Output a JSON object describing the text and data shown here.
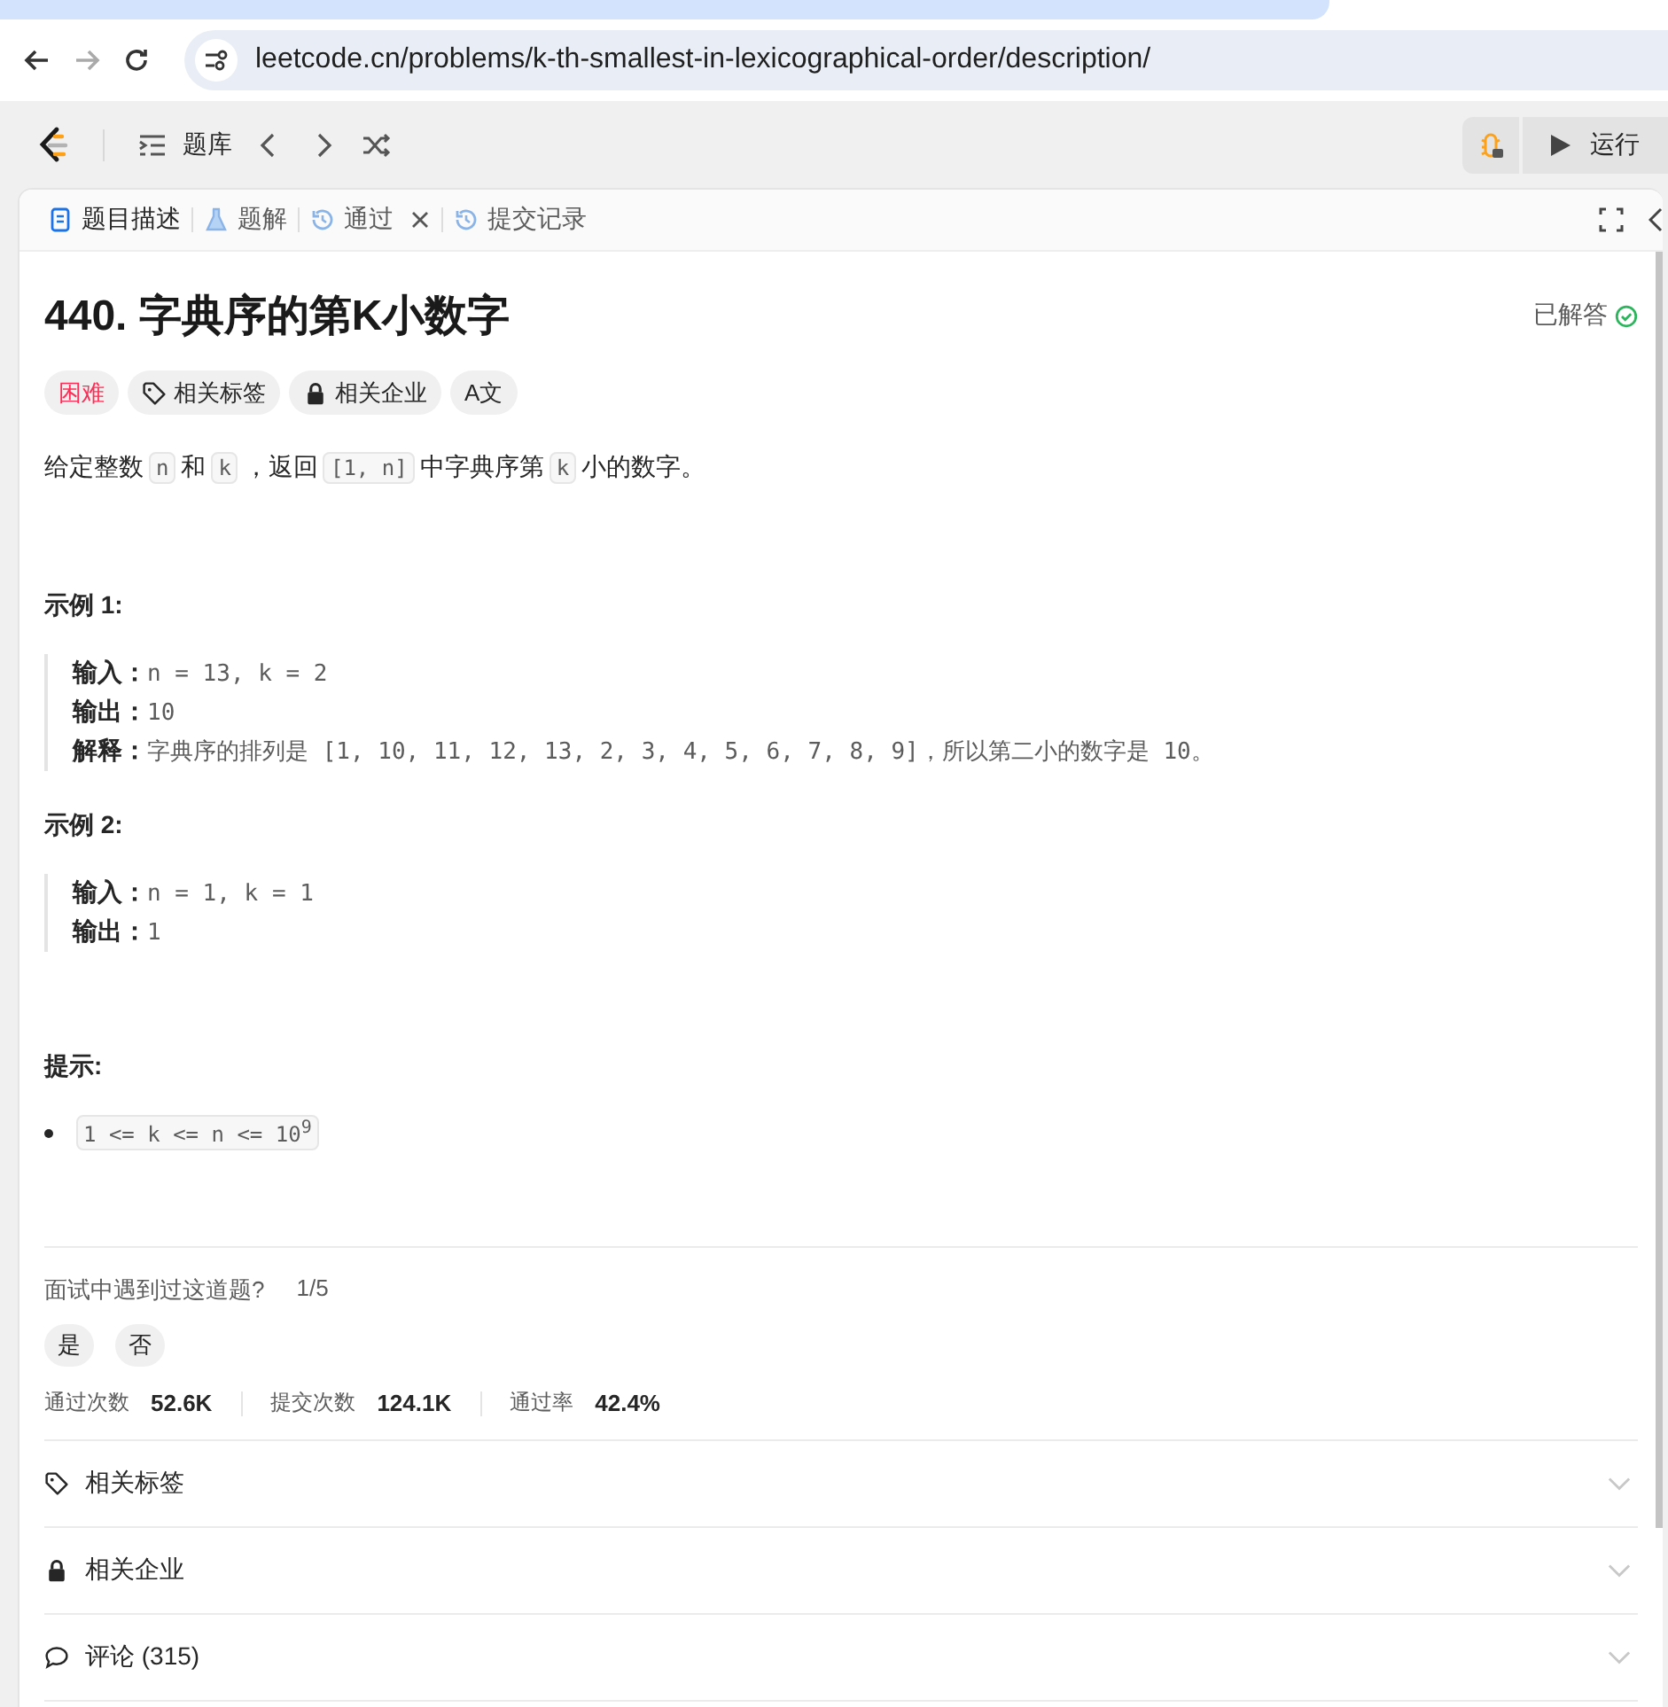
{
  "browser": {
    "url": "leetcode.cn/problems/k-th-smallest-in-lexicographical-order/description/"
  },
  "toolbar": {
    "problem_list": "题库",
    "run": "运行"
  },
  "tabs": [
    {
      "label": "题目描述",
      "selected": true,
      "closable": false
    },
    {
      "label": "题解",
      "selected": false,
      "closable": false
    },
    {
      "label": "通过",
      "selected": false,
      "closable": true
    },
    {
      "label": "提交记录",
      "selected": false,
      "closable": false
    }
  ],
  "problem": {
    "title": "440. 字典序的第K小数字",
    "status": "已解答",
    "tags": [
      {
        "kind": "difficulty",
        "label": "困难"
      },
      {
        "kind": "topics",
        "label": "相关标签"
      },
      {
        "kind": "companies",
        "label": "相关企业"
      },
      {
        "kind": "translate",
        "label": "A文"
      }
    ],
    "description": [
      {
        "text": "给定整数",
        "code": false
      },
      {
        "text": "n",
        "code": true
      },
      {
        "text": "和",
        "code": false
      },
      {
        "text": "k",
        "code": true
      },
      {
        "text": "，返回",
        "code": false
      },
      {
        "text": "[1, n]",
        "code": true
      },
      {
        "text": "中字典序第",
        "code": false
      },
      {
        "text": "k",
        "code": true
      },
      {
        "text": "小的数字。",
        "code": false
      }
    ],
    "examples": [
      {
        "title": "示例 1:",
        "lines": [
          {
            "label": "输入：",
            "value": "n = 13, k = 2"
          },
          {
            "label": "输出：",
            "value": "10"
          },
          {
            "label": "解释：",
            "value": "字典序的排列是 [1, 10, 11, 12, 13, 2, 3, 4, 5, 6, 7, 8, 9]，所以第二小的数字是 10。"
          }
        ]
      },
      {
        "title": "示例 2:",
        "lines": [
          {
            "label": "输入：",
            "value": "n = 1, k = 1"
          },
          {
            "label": "输出：",
            "value": "1"
          }
        ]
      }
    ],
    "hints_title": "提示:",
    "hints": [
      "1 <= k <= n <= 10$^{9}$"
    ],
    "interview": {
      "question": "面试中遇到过这道题?",
      "count": "1/5",
      "answers": [
        "是",
        "否"
      ]
    },
    "stats": [
      {
        "label": "通过次数",
        "value": "52.6K"
      },
      {
        "label": "提交次数",
        "value": "124.1K"
      },
      {
        "label": "通过率",
        "value": "42.4%"
      }
    ],
    "sections": [
      {
        "kind": "tag",
        "label": "相关标签"
      },
      {
        "kind": "lock",
        "label": "相关企业"
      },
      {
        "kind": "comment",
        "label": "评论 (315)"
      }
    ]
  }
}
